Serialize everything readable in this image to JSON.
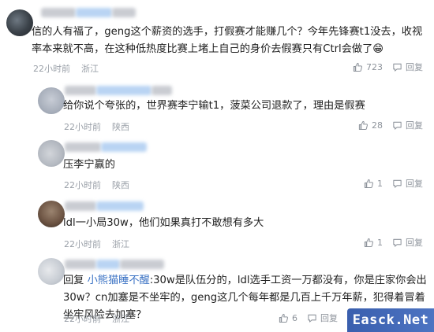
{
  "comments": [
    {
      "text": "信的人有福了，geng这个薪资的选手，打假赛才能赚几个？今年先锋赛t1没去，收视率本来就不高，在这种低热度比赛上堵上自己的身价去假赛只有Ctrl会做了😁",
      "time": "22小时前",
      "location": "浙江",
      "likes": "723",
      "reply_label": "回复"
    },
    {
      "text": "给你说个夸张的，世界赛李宁输t1，菠菜公司退款了，理由是假赛",
      "time": "22小时前",
      "location": "陕西",
      "likes": "28",
      "reply_label": "回复"
    },
    {
      "text": "压李宁赢的",
      "time": "22小时前",
      "location": "陕西",
      "likes": "1",
      "reply_label": "回复"
    },
    {
      "text": "ldl一小局30w，他们如果真打不敢想有多大",
      "time": "22小时前",
      "location": "浙江",
      "likes": "1",
      "reply_label": "回复"
    },
    {
      "reply_prefix": "回复",
      "mention": "小熊猫睡不醒",
      "text": ":30w是队伍分的，ldl选手工资一万都没有，你是庄家你会出30w？cn加塞是不坐牢的，geng这几个每年都是几百上千万年薪，犯得着冒着坐牢风险去加塞？",
      "time": "22小时前",
      "location": "浙江",
      "likes": "6",
      "reply_label": "回复"
    }
  ],
  "watermark": "Easck.Net"
}
